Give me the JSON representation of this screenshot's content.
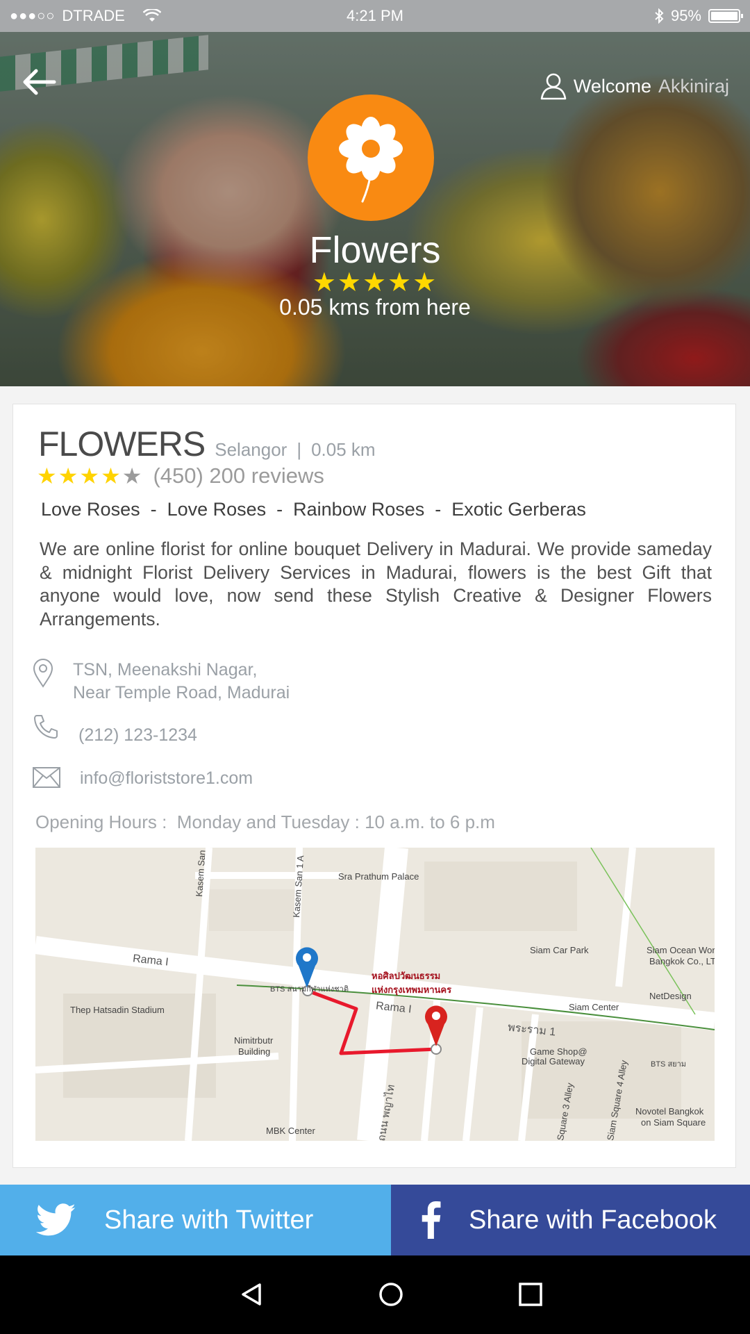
{
  "status_bar": {
    "signal": "●●●○○",
    "carrier": "DTRADE",
    "time": "4:21 PM",
    "battery": "95%"
  },
  "hero": {
    "welcome": "Welcome",
    "user_name": "Akkiniraj",
    "title": "Flowers",
    "stars": "★★★★★",
    "distance": "0.05 kms from here"
  },
  "shop": {
    "title": "FLOWERS",
    "location": "Selangor",
    "separator": "|",
    "distance": "0.05 km",
    "rating": 4,
    "rating_max": 5,
    "reviews": "(450) 200 reviews",
    "tags": "Love Roses  -  Love Roses  -  Rainbow Roses  -  Exotic Gerberas",
    "description": "We are online florist for online bouquet Delivery in Madurai. We provide sameday & midnight Florist Delivery Services in Madurai, flowers is the best Gift that anyone would love, now send these Stylish Creative & Designer Flowers Arrangements.",
    "address_line1": "TSN, Meenakshi Nagar,",
    "address_line2": "Near Temple Road, Madurai",
    "phone": "(212) 123-1234",
    "email": "info@floriststore1.com",
    "hours_label": "Opening Hours :",
    "hours": "Monday and Tuesday : 10 a.m. to 6 p.m"
  },
  "map": {
    "labels": {
      "sra_prathum": "Sra Prathum Palace",
      "kasem_san": "Kasem San",
      "kasem_san1": "Kasem San 1 A",
      "rama1_left": "Rama I",
      "rama1_center": "Rama I",
      "thai_heading": "หอศิลปวัฒนธรรม",
      "thai_heading2": "แห่งกรุงเทพมหานคร",
      "thai_rama": "พระราม 1",
      "thai_phayathai": "ถนน พญาไท",
      "thep_stadium": "Thep Hatsadin Stadium",
      "siam_car_park": "Siam Car Park",
      "siam_ocean": "Siam Ocean Wor",
      "bangkok_co": "Bangkok Co., LT",
      "net_design": "NetDesign",
      "siam_center": "Siam Center",
      "nimitrbutr": "Nimitrbutr",
      "building": "Building",
      "game_shop": "Game Shop@",
      "digital_gateway": "Digital Gateway",
      "square3": "Square 3 Alley",
      "square4": "Siam Square 4 Alley",
      "novotel": "Novotel Bangkok",
      "on_siam": "on Siam Square",
      "mbk": "MBK Center",
      "bts1": "BTS สนามกีฬาแห่งชาติ",
      "bts2": "BTS สยาม"
    }
  },
  "share": {
    "twitter": "Share with Twitter",
    "facebook": "Share with Facebook"
  },
  "colors": {
    "brand_orange": "#f98a12",
    "twitter_blue": "#52afea",
    "facebook_blue": "#354a99",
    "star_yellow": "#ffd300",
    "route_red": "#e8192c",
    "pin_blue": "#1f77c9",
    "pin_red": "#d8231f"
  },
  "icons": [
    "back-arrow-icon",
    "user-icon",
    "flower-icon",
    "location-pin-icon",
    "phone-icon",
    "envelope-icon",
    "twitter-icon",
    "facebook-icon",
    "nav-back-icon",
    "nav-home-icon",
    "nav-recents-icon",
    "wifi-icon",
    "bluetooth-icon",
    "battery-icon"
  ]
}
